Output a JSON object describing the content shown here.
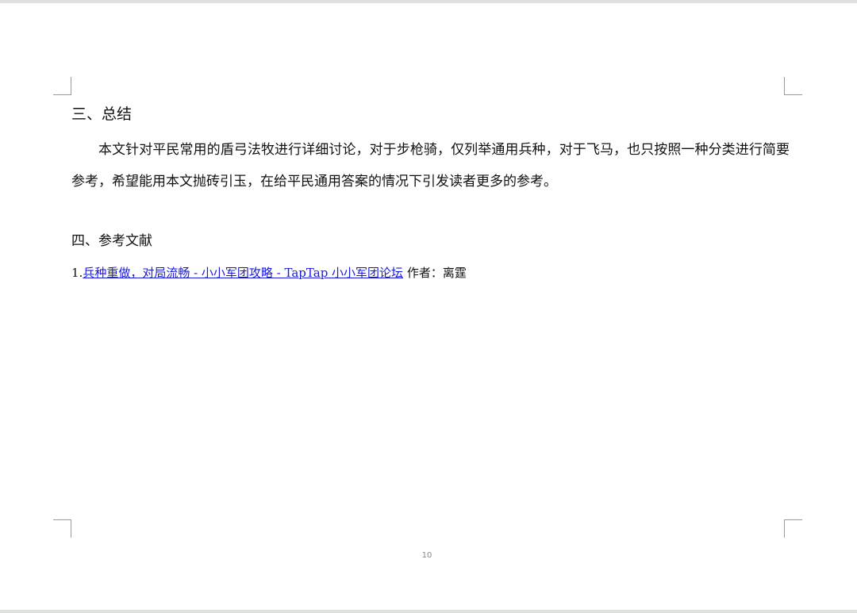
{
  "section_conclusion": {
    "heading": "三、总结",
    "body": "本文针对平民常用的盾弓法牧进行详细讨论，对于步枪骑，仅列举通用兵种，对于飞马，也只按照一种分类进行简要参考，希望能用本文抛砖引玉，在给平民通用答案的情况下引发读者更多的参考。"
  },
  "section_references": {
    "heading": "四、参考文献",
    "items": [
      {
        "number": "1.",
        "link_text": "兵种重做，对局流畅 - 小小军团攻略 - TapTap 小小军团论坛",
        "author": "作者：离霆"
      }
    ]
  },
  "footer": {
    "page_number": "10"
  }
}
